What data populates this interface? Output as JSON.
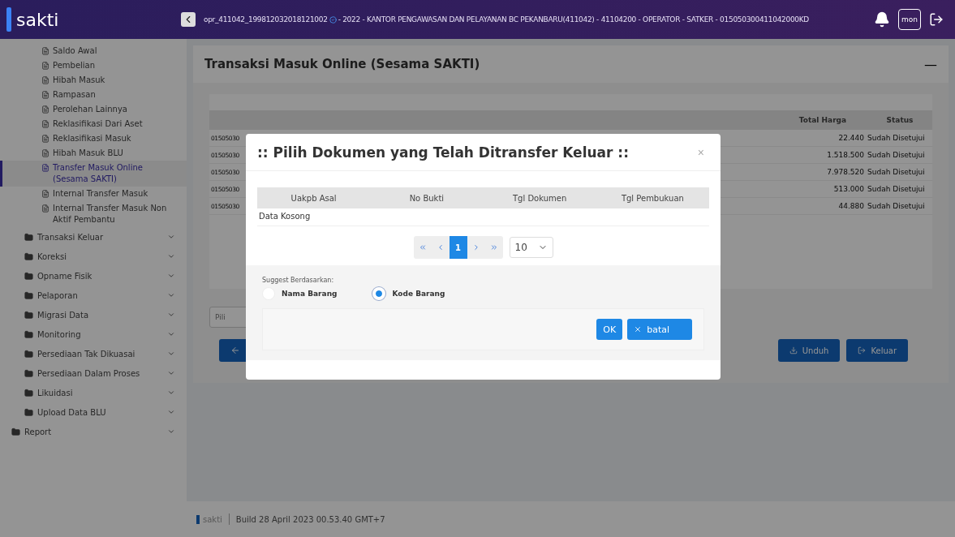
{
  "header": {
    "logo": "sakti",
    "user_id": "opr_411042_199812032018121002",
    "user_info": " - 2022 - KANTOR PENGAWASAN DAN PELAYANAN BC PEKANBARU(411042) - 41104200 - OPERATOR - SATKER - 015050300411042000KD",
    "avatar_text": "mon"
  },
  "sidebar": {
    "pages": [
      {
        "label": "Saldo Awal",
        "selected": false
      },
      {
        "label": "Pembelian",
        "selected": false
      },
      {
        "label": "Hibah Masuk",
        "selected": false
      },
      {
        "label": "Rampasan",
        "selected": false
      },
      {
        "label": "Perolehan Lainnya",
        "selected": false
      },
      {
        "label": "Reklasifikasi Dari Aset",
        "selected": false
      },
      {
        "label": "Reklasifikasi Masuk",
        "selected": false
      },
      {
        "label": "Hibah Masuk BLU",
        "selected": false
      },
      {
        "label": "Transfer Masuk Online (Sesama SAKTI)",
        "selected": true
      },
      {
        "label": "Internal Transfer Masuk",
        "selected": false
      },
      {
        "label": "Internal Transfer Masuk Non Aktif Pembantu",
        "selected": false
      }
    ],
    "folders": [
      "Transaksi Keluar",
      "Koreksi",
      "Opname Fisik",
      "Pelaporan",
      "Migrasi Data",
      "Monitoring",
      "Persediaan Tak Dikuasai",
      "Persediaan Dalam Proses",
      "Likuidasi",
      "Upload Data BLU"
    ],
    "sections": [
      "Report"
    ]
  },
  "page": {
    "title": "Transaksi Masuk Online (Sesama SAKTI)",
    "minimize": "—",
    "table": {
      "columns": [
        "Total Harga",
        "Status"
      ],
      "rows": [
        {
          "column_1": "01505030",
          "total_harga": "22.440",
          "status": "Sudah Disetujui"
        },
        {
          "column_1": "01505030",
          "total_harga": "1.518.500",
          "status": "Sudah Disetujui"
        },
        {
          "column_1": "01505030",
          "total_harga": "7.978.520",
          "status": "Sudah Disetujui"
        },
        {
          "column_1": "01505030",
          "total_harga": "513.000",
          "status": "Sudah Disetujui"
        },
        {
          "column_1": "01505030",
          "total_harga": "44.880",
          "status": "Sudah Disetujui"
        }
      ]
    },
    "filter_field": "Pili",
    "buttons": [
      "Unduh",
      "Keluar"
    ]
  },
  "modal": {
    "title": ":: Pilih Dokumen yang Telah Ditransfer Keluar ::",
    "close": "×",
    "columns": [
      "Uakpb Asal",
      "No Bukti",
      "Tgl Dokumen",
      "Tgl Pembukuan"
    ],
    "empty_text": "Data Kosong",
    "pages": [
      {
        "label": "1",
        "selected": true
      }
    ],
    "page_size": "10",
    "suggest_label": "Suggest Berdasarkan:",
    "options": [
      {
        "label": "Nama Barang",
        "selected": false
      },
      {
        "label": "Kode Barang",
        "selected": true
      }
    ],
    "ok": "OK",
    "cancel": "batal"
  },
  "footer": {
    "logo": "sakti",
    "build": "Build 28 April 2023 00.53.40 GMT+7"
  }
}
